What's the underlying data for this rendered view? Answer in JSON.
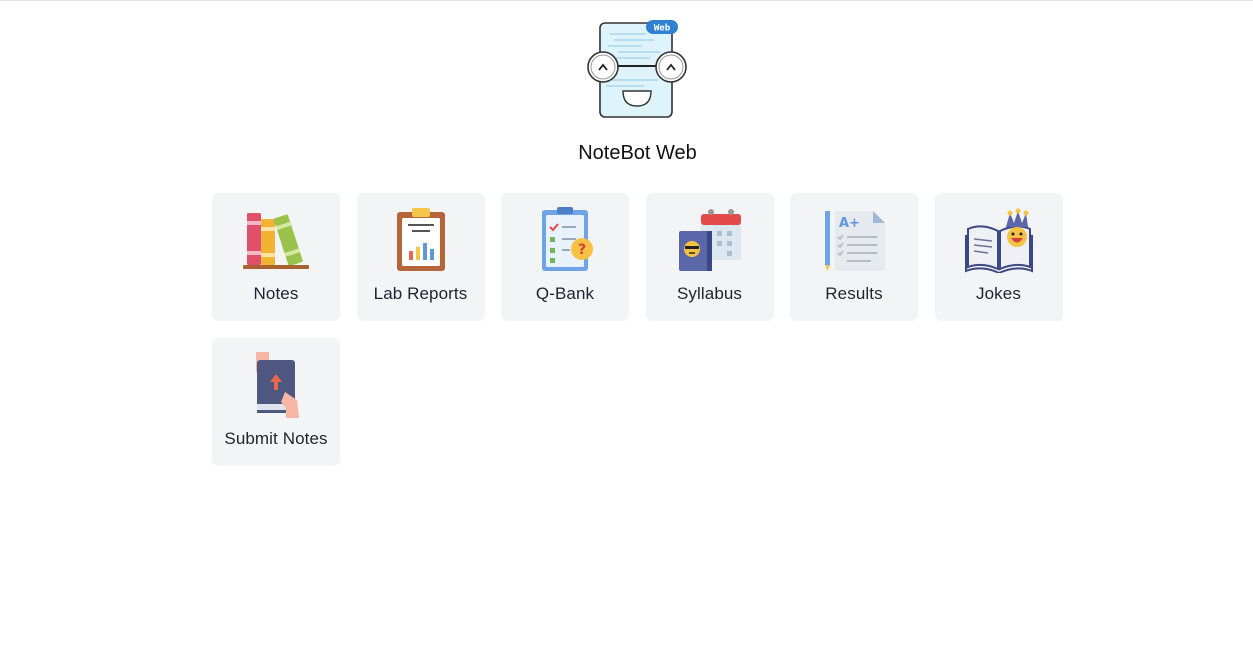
{
  "app": {
    "title": "NoteBot Web",
    "logo_badge": "Web",
    "logo_icon": "notebot-logo-icon"
  },
  "menu": {
    "items": [
      {
        "label": "Notes",
        "icon": "books-icon"
      },
      {
        "label": "Lab Reports",
        "icon": "clipboard-chart-icon"
      },
      {
        "label": "Q-Bank",
        "icon": "question-checklist-icon"
      },
      {
        "label": "Syllabus",
        "icon": "calendar-book-icon"
      },
      {
        "label": "Results",
        "icon": "grade-sheet-icon"
      },
      {
        "label": "Jokes",
        "icon": "jester-book-icon"
      },
      {
        "label": "Submit Notes",
        "icon": "hand-upload-book-icon"
      }
    ]
  },
  "colors": {
    "card_bg": "#f3f4f6",
    "badge": "#2f80d1"
  }
}
